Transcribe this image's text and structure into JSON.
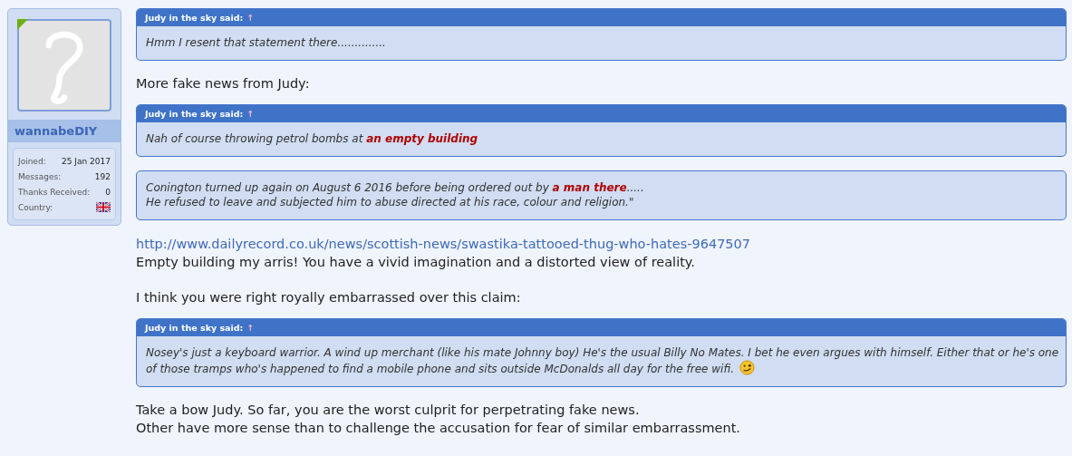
{
  "user": {
    "name": "wannabeDIY",
    "online": true,
    "stats": [
      {
        "label": "Joined:",
        "value": "25 Jan 2017"
      },
      {
        "label": "Messages:",
        "value": "192"
      },
      {
        "label": "Thanks Received:",
        "value": "0"
      },
      {
        "label": "Country:",
        "kind": "flag"
      }
    ]
  },
  "post": [
    {
      "kind": "quote",
      "author": "Judy in the sky said:",
      "arrow": "↑",
      "lines": [
        "Hmm I resent that statement there.............."
      ]
    },
    {
      "kind": "text",
      "text": "More fake news from Judy:"
    },
    {
      "kind": "quote",
      "author": "Judy in the sky said:",
      "arrow": "↑",
      "lines": [
        "Nah of course throwing petrol bombs at **an empty building**"
      ]
    },
    {
      "kind": "quote",
      "lines": [
        "Conington turned up again on August 6 2016 before being ordered out by **a man there**.....",
        "He refused to leave and subjected him to abuse directed at his race, colour and religion.\""
      ]
    },
    {
      "kind": "link",
      "text": "http://www.dailyrecord.co.uk/news/scottish-news/swastika-tattooed-thug-who-hates-9647507"
    },
    {
      "kind": "text",
      "text": "Empty building my arris! You have a vivid imagination and a distorted view of reality."
    },
    {
      "kind": "blank"
    },
    {
      "kind": "text",
      "text": "I think you were right royally embarrassed over this claim:"
    },
    {
      "kind": "quote_smiley",
      "author": "Judy in the sky said:",
      "arrow": "↑",
      "lines": [
        "Nosey's just a keyboard warrior. A wind up merchant (like his mate Johnny boy) He's the usual Billy No Mates. I bet he even argues with himself. Either that or he's one",
        "of those tramps who's happened to find a mobile phone and sits outside McDonalds all day for the free wifi."
      ]
    },
    {
      "kind": "text",
      "text": "Take a bow Judy. So far, you are the worst culprit for perpetrating fake news."
    },
    {
      "kind": "text",
      "text": "Other have more sense than to challenge the accusation for fear of similar embarrassment."
    }
  ]
}
